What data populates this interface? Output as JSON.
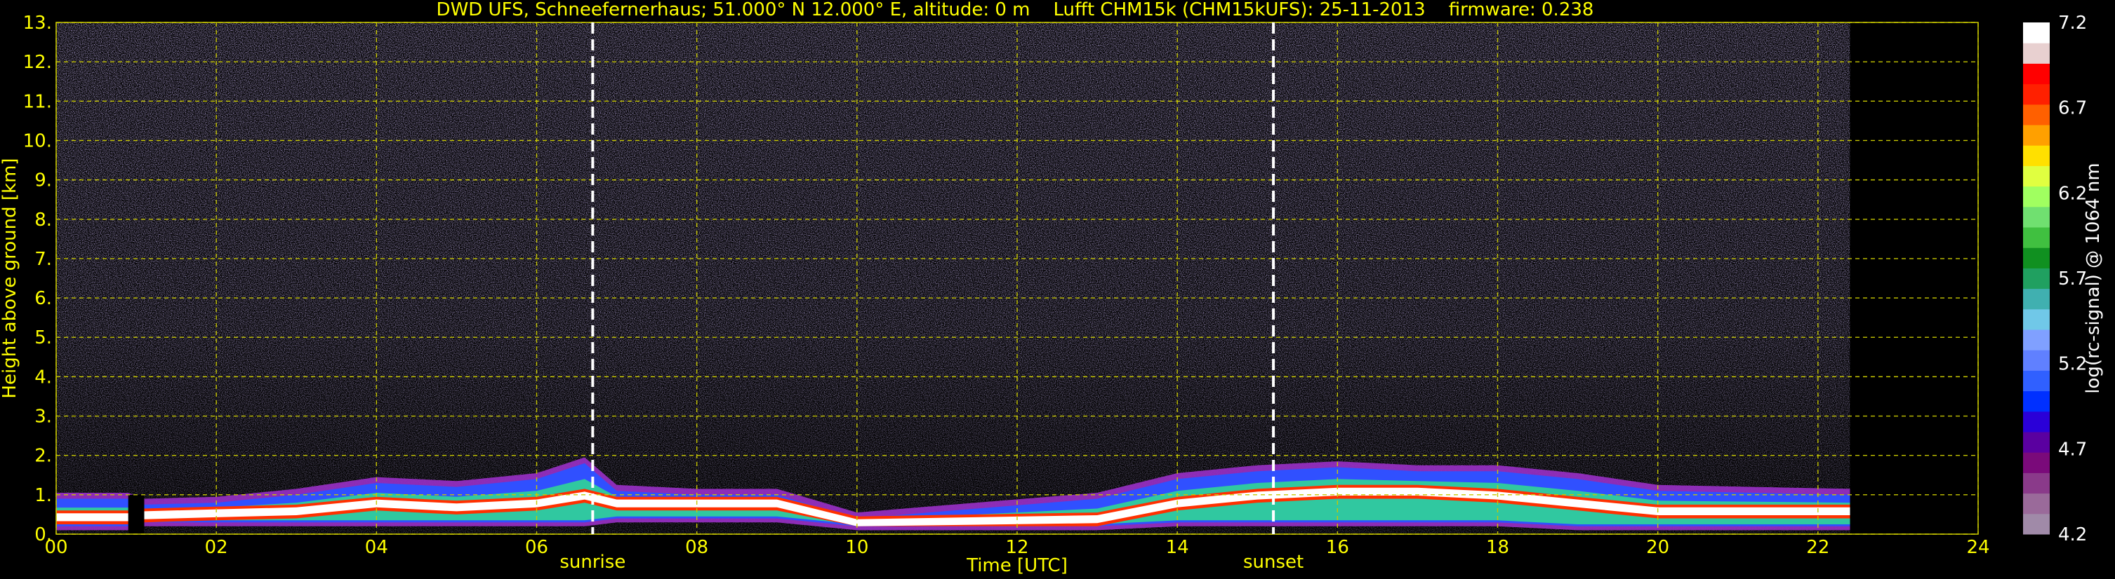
{
  "chart_data": {
    "type": "heatmap",
    "title": "DWD UFS, Schneefernerhaus; 51.000° N 12.000° E, altitude: 0 m    Lufft CHM15k (CHM15kUFS): 25-11-2013    firmware: 0.238",
    "xlabel": "Time [UTC]",
    "ylabel": "Height above ground [km]",
    "xlim": [
      0,
      24
    ],
    "ylim": [
      0,
      13
    ],
    "x_ticks": [
      "00",
      "02",
      "04",
      "06",
      "08",
      "10",
      "12",
      "14",
      "16",
      "18",
      "20",
      "22",
      "24"
    ],
    "y_ticks": [
      "0.",
      "1.",
      "2.",
      "3.",
      "4.",
      "5.",
      "6.",
      "7.",
      "8.",
      "9.",
      "10.",
      "11.",
      "12.",
      "13."
    ],
    "grid": true,
    "data_end_hour": 22.4,
    "events": [
      {
        "label": "sunrise",
        "hour": 6.7
      },
      {
        "label": "sunset",
        "hour": 15.2
      }
    ],
    "colorbar": {
      "label": "log(rc-signal) @ 1064 nm",
      "min": 4.2,
      "max": 7.2,
      "ticks": [
        "4.2",
        "4.7",
        "5.2",
        "5.7",
        "6.2",
        "6.7",
        "7.2"
      ],
      "colors": [
        "#a08aa8",
        "#9a6a9a",
        "#8a3a8a",
        "#7a0a7a",
        "#5a00a0",
        "#2a00d8",
        "#0030ff",
        "#3060ff",
        "#6080ff",
        "#80a0ff",
        "#70c8e8",
        "#40b0b0",
        "#20a060",
        "#109020",
        "#40c040",
        "#70e070",
        "#a0ff60",
        "#e0ff40",
        "#ffe000",
        "#ffa000",
        "#ff6000",
        "#ff2000",
        "#ff0000",
        "#e8d0d0",
        "#ffffff"
      ]
    },
    "boundary_layer": [
      {
        "x": 0.0,
        "base": 0.2,
        "top": 0.9,
        "core": 0.45
      },
      {
        "x": 0.9,
        "base": 0.2,
        "top": 0.9,
        "core": 0.45
      },
      {
        "x": 1.1,
        "base": 0.3,
        "top": 0.75,
        "core": 0.5
      },
      {
        "x": 2.0,
        "base": 0.3,
        "top": 0.8,
        "core": 0.55
      },
      {
        "x": 3.0,
        "base": 0.3,
        "top": 1.0,
        "core": 0.6
      },
      {
        "x": 4.0,
        "base": 0.3,
        "top": 1.3,
        "core": 0.8
      },
      {
        "x": 5.0,
        "base": 0.3,
        "top": 1.2,
        "core": 0.7
      },
      {
        "x": 6.0,
        "base": 0.3,
        "top": 1.4,
        "core": 0.8
      },
      {
        "x": 6.6,
        "base": 0.3,
        "top": 1.8,
        "core": 1.0
      },
      {
        "x": 7.0,
        "base": 0.4,
        "top": 1.1,
        "core": 0.8
      },
      {
        "x": 8.0,
        "base": 0.4,
        "top": 1.0,
        "core": 0.8
      },
      {
        "x": 9.0,
        "base": 0.4,
        "top": 1.0,
        "core": 0.8
      },
      {
        "x": 10.0,
        "base": 0.2,
        "top": 0.4,
        "core": 0.3
      },
      {
        "x": 13.0,
        "base": 0.2,
        "top": 0.9,
        "core": 0.4
      },
      {
        "x": 14.0,
        "base": 0.3,
        "top": 1.4,
        "core": 0.8
      },
      {
        "x": 15.0,
        "base": 0.3,
        "top": 1.6,
        "core": 1.0
      },
      {
        "x": 16.0,
        "base": 0.3,
        "top": 1.7,
        "core": 1.1
      },
      {
        "x": 17.0,
        "base": 0.3,
        "top": 1.6,
        "core": 1.1
      },
      {
        "x": 18.0,
        "base": 0.3,
        "top": 1.6,
        "core": 1.0
      },
      {
        "x": 19.0,
        "base": 0.2,
        "top": 1.4,
        "core": 0.8
      },
      {
        "x": 20.0,
        "base": 0.2,
        "top": 1.1,
        "core": 0.6
      },
      {
        "x": 22.4,
        "base": 0.2,
        "top": 1.0,
        "core": 0.6
      }
    ]
  }
}
